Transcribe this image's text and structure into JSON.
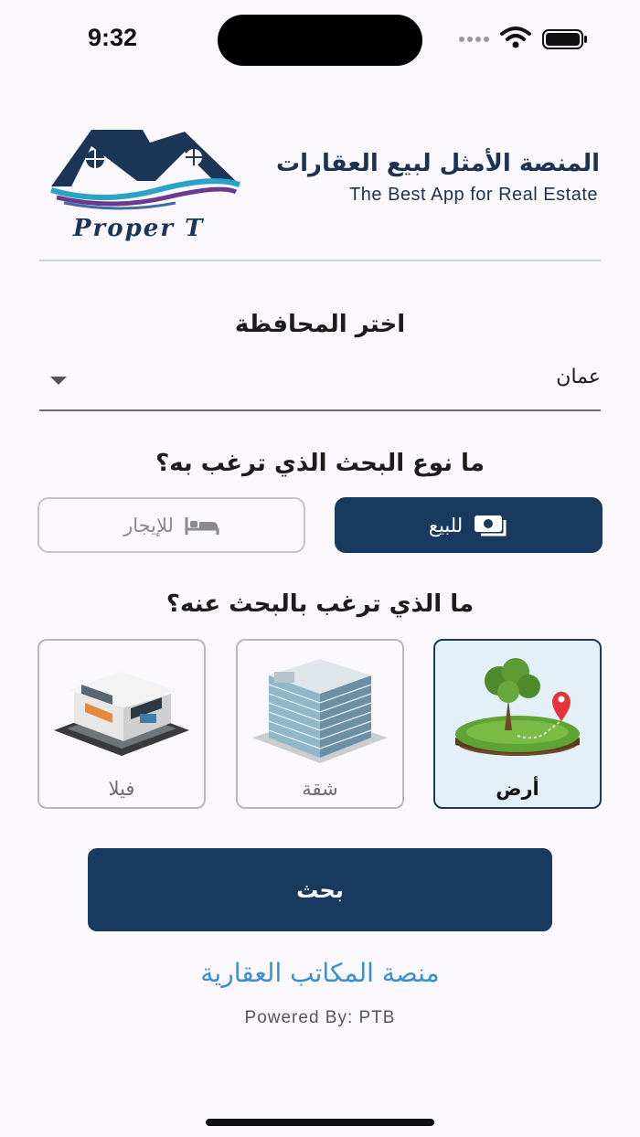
{
  "status": {
    "time": "9:32"
  },
  "header": {
    "brand_name": "Proper T",
    "tagline_ar": "المنصة الأمثل لبيع العقارات",
    "tagline_en": "The Best App for Real Estate"
  },
  "governorate": {
    "label": "اختر المحافظة",
    "selected": "عمان"
  },
  "search_type": {
    "label": "ما نوع البحث الذي ترغب به؟",
    "sale_label": "للبيع",
    "rent_label": "للإيجار",
    "selected": "sale"
  },
  "property_type": {
    "label": "ما الذي ترغب بالبحث عنه؟",
    "cards": [
      {
        "label": "أرض",
        "icon": "land-image",
        "selected": true
      },
      {
        "label": "شقة",
        "icon": "apartment-building-image",
        "selected": false
      },
      {
        "label": "فيلا",
        "icon": "villa-image",
        "selected": false
      }
    ]
  },
  "actions": {
    "search_label": "بحث"
  },
  "footer": {
    "offices_link": "منصة المكاتب العقارية",
    "powered_by": "Powered By: PTB"
  },
  "colors": {
    "primary": "#173a5e",
    "link": "#3a8fd0",
    "background": "#fbf8fd"
  }
}
